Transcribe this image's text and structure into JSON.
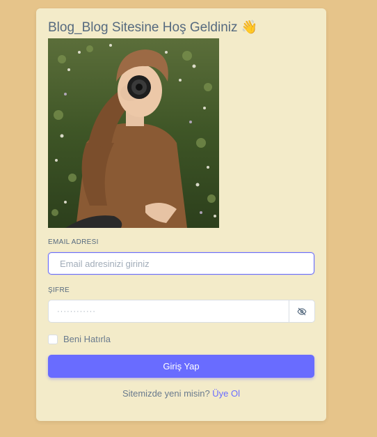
{
  "page": {
    "title": "Blog_Blog Sitesine Hoş Geldiniz 👋"
  },
  "form": {
    "email_label": "EMAIL ADRESI",
    "email_placeholder": "Email adresinizi giriniz",
    "password_label": "ŞIFRE",
    "password_placeholder": "············",
    "remember_label": "Beni Hatırla",
    "remember_checked": false,
    "submit_label": "Giriş Yap"
  },
  "footer": {
    "prompt": "Sitemizde yeni misin?",
    "link": "Üye Ol"
  },
  "icons": {
    "password_toggle": "eye-off-icon"
  },
  "colors": {
    "page_background": "#e6c48a",
    "card_background": "#f3ebc9",
    "accent": "#696cff",
    "heading": "#566a7f"
  }
}
